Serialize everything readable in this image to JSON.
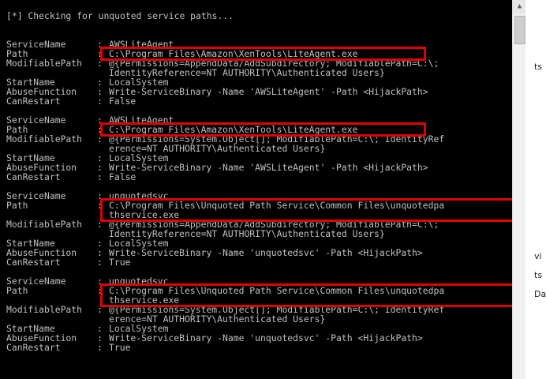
{
  "console": {
    "header": "[*] Checking for unquoted service paths...",
    "entries": [
      {
        "service_name": "AWSLiteAgent",
        "path": [
          "C:\\Program Files\\Amazon\\XenTools\\LiteAgent.exe"
        ],
        "modifiable_path": [
          "@{Permissions=AppendData/AddSubdirectory; ModifiablePath=C:\\;",
          "IdentityReference=NT AUTHORITY\\Authenticated Users}"
        ],
        "start_name": "LocalSystem",
        "abuse_function": "Write-ServiceBinary -Name 'AWSLiteAgent' -Path <HijackPath>",
        "can_restart": "False"
      },
      {
        "service_name": "AWSLiteAgent",
        "path": [
          "C:\\Program Files\\Amazon\\XenTools\\LiteAgent.exe"
        ],
        "modifiable_path": [
          "@{Permissions=System.Object[]; ModifiablePath=C:\\; IdentityRef",
          "erence=NT AUTHORITY\\Authenticated Users}"
        ],
        "start_name": "LocalSystem",
        "abuse_function": "Write-ServiceBinary -Name 'AWSLiteAgent' -Path <HijackPath>",
        "can_restart": "False"
      },
      {
        "service_name": "unquotedsvc",
        "path": [
          "C:\\Program Files\\Unquoted Path Service\\Common Files\\unquotedpa",
          "thservice.exe"
        ],
        "modifiable_path": [
          "@{Permissions=AppendData/AddSubdirectory; ModifiablePath=C:\\;",
          "IdentityReference=NT AUTHORITY\\Authenticated Users}"
        ],
        "start_name": "LocalSystem",
        "abuse_function": "Write-ServiceBinary -Name 'unquotedsvc' -Path <HijackPath>",
        "can_restart": "True"
      },
      {
        "service_name": "unquotedsvc",
        "path": [
          "C:\\Program Files\\Unquoted Path Service\\Common Files\\unquotedpa",
          "thservice.exe"
        ],
        "modifiable_path": [
          "@{Permissions=System.Object[]; ModifiablePath=C:\\; IdentityRef",
          "erence=NT AUTHORITY\\Authenticated Users}"
        ],
        "start_name": "LocalSystem",
        "abuse_function": "Write-ServiceBinary -Name 'unquotedsvc' -Path <HijackPath>",
        "can_restart": "True"
      }
    ]
  },
  "labels": {
    "service_name": "ServiceName",
    "path": "Path",
    "modifiable_path": "ModifiablePath",
    "start_name": "StartName",
    "abuse_function": "AbuseFunction",
    "can_restart": "CanRestart",
    "separator": ":"
  },
  "background_window": {
    "fragments": [
      "ts",
      "vi",
      "ts",
      "Daf"
    ]
  },
  "colors": {
    "console_bg": "#000000",
    "console_text": "#c0c0c0",
    "highlight_box": "#e00000"
  },
  "icons": {
    "scroll_up": "triangle-up"
  }
}
